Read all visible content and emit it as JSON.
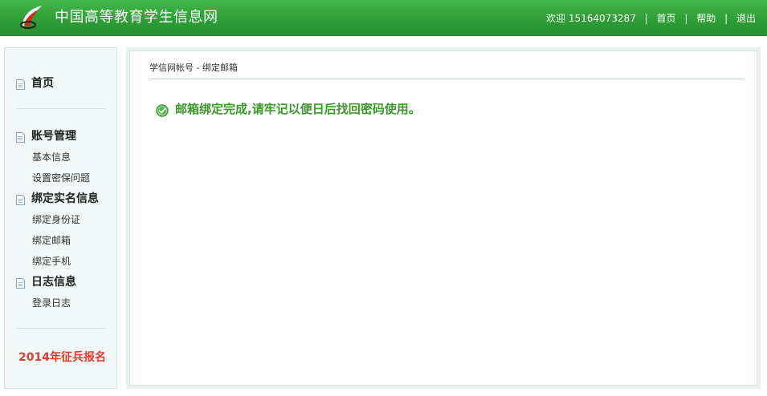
{
  "header": {
    "site_title": "中国高等教育学生信息网",
    "welcome": "欢迎 15164073287",
    "links": [
      "首页",
      "帮助",
      "退出"
    ]
  },
  "sidebar": {
    "home": "首页",
    "account": {
      "title": "账号管理",
      "items": [
        "基本信息",
        "设置密保问题"
      ]
    },
    "realname": {
      "title": "绑定实名信息",
      "items": [
        "绑定身份证",
        "绑定邮箱",
        "绑定手机"
      ]
    },
    "log": {
      "title": "日志信息",
      "items": [
        "登录日志"
      ]
    },
    "recruit": "2014年征兵报名"
  },
  "main": {
    "breadcrumb": "学信网帐号 - 绑定邮箱",
    "success_message": "邮箱绑定完成,请牢记以便日后找回密码使用。"
  },
  "colors": {
    "header_green": "#2e9e36",
    "success_green": "#3a9a2a",
    "recruit_red": "#e23b2c"
  }
}
